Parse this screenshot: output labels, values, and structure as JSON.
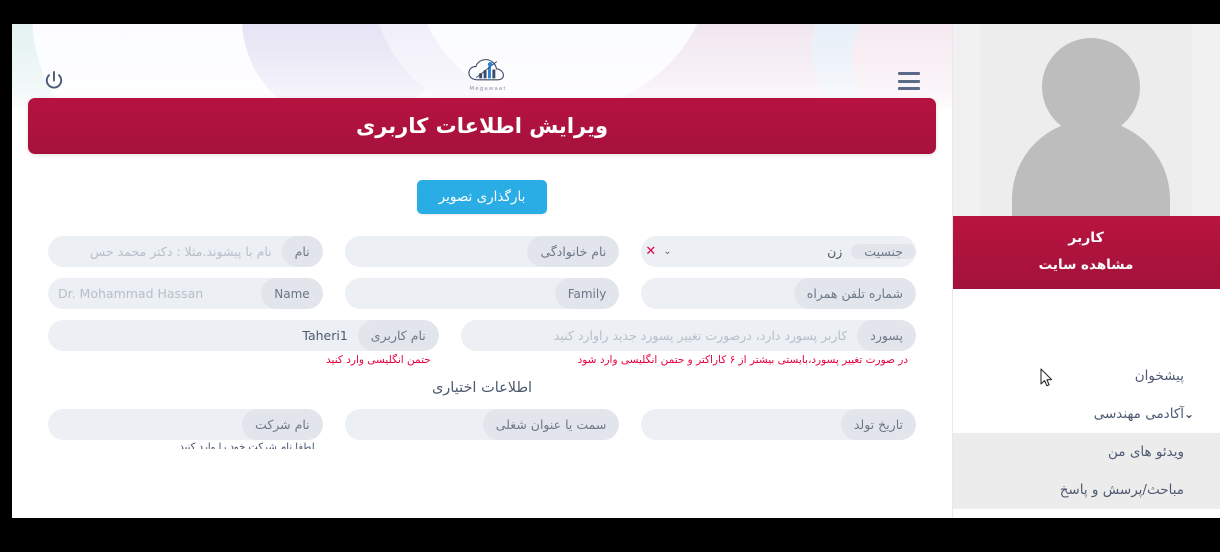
{
  "header": {
    "power_icon": "power-icon",
    "menu_icon": "hamburger-icon",
    "logo_text": "Megawaat"
  },
  "page_title": "ویرایش اطلاعات کاربری",
  "form": {
    "upload_button": "بارگذاری تصویر",
    "row1": {
      "name": {
        "label": "نام",
        "placeholder": "نام با پیشوند.مثلا : دکتر محمد حس",
        "value": ""
      },
      "family": {
        "label": "نام خانوادگی",
        "placeholder": "",
        "value": ""
      },
      "gender": {
        "label": "جنسیت",
        "value": "زن",
        "clear": "✕",
        "caret": "⌄"
      }
    },
    "row2": {
      "name_en": {
        "label": "Name",
        "placeholder": "Dr. Mohammad Hassan",
        "value": ""
      },
      "family_en": {
        "label": "Family",
        "placeholder": "",
        "value": ""
      },
      "mobile": {
        "label": "شماره تلفن همراه",
        "placeholder": "",
        "value": ""
      }
    },
    "row3": {
      "password": {
        "label": "پسورد",
        "placeholder": "کاربر پسورد دارد، درصورت تغییر پسورد جدید راوارد کنید",
        "value": "",
        "helper": "در صورت تغییر پسورد،بایستی بیشتر از ۶ کاراکتر و حتمن انگلیسی وارد شود"
      },
      "username": {
        "label": "نام کاربری",
        "value": "Taheri1",
        "placeholder": "",
        "helper": "حتمن انگلیسی وارد کنید"
      }
    },
    "optional_section_title": "اطلاعات اختیاری",
    "row4": {
      "company": {
        "label": "نام شرکت",
        "placeholder": "",
        "value": ""
      },
      "job_title": {
        "label": "سمت یا عنوان شغلی",
        "placeholder": "",
        "value": ""
      },
      "birthdate": {
        "label": "تاریخ تولد",
        "placeholder": "",
        "value": ""
      }
    },
    "cut_helper": "لطفا نام شرکت خود را وارد کنید"
  },
  "sidebar": {
    "avatar": "user-avatar-placeholder",
    "user_title": "کاربر",
    "view_site": "مشاهده سایت",
    "nav": [
      {
        "label": "پیشخوان",
        "caret": "",
        "shaded": false
      },
      {
        "label": "آکادمی مهندسی",
        "caret": "⌄",
        "shaded": false
      },
      {
        "label": "ویدئو های من",
        "caret": "",
        "shaded": true
      },
      {
        "label": "مباحث/پرسش و پاسخ",
        "caret": "",
        "shaded": true
      }
    ]
  },
  "colors": {
    "crimson": "#b7123f",
    "accent_blue": "#29ade4",
    "helper_red": "#e8003c",
    "field_bg": "#eceff3"
  }
}
